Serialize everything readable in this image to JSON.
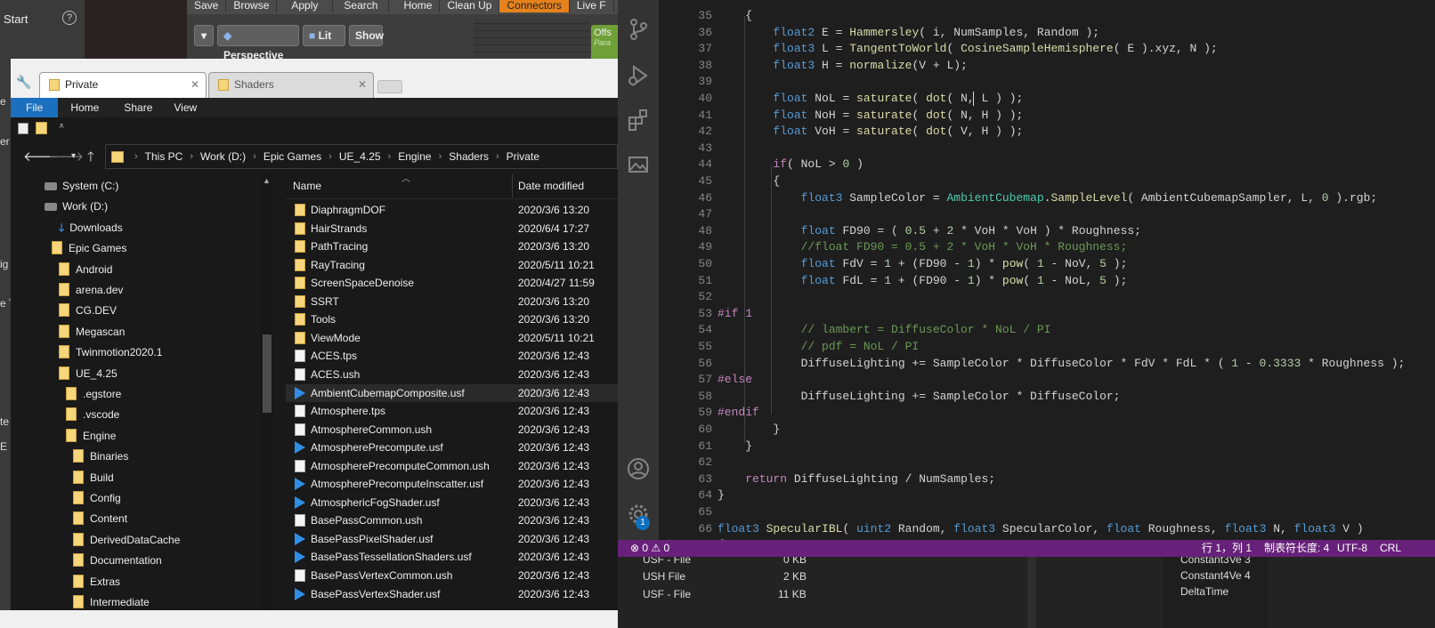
{
  "background": {
    "start_label": "Start",
    "help_icon": "?",
    "toolbar": [
      "Save",
      "Browse",
      "Apply",
      "Search",
      "Home",
      "Clean Up",
      "Connectors",
      "Live F"
    ],
    "viewport_buttons": [
      "Perspective",
      "Lit",
      "Show"
    ],
    "green_panel": [
      "Offs",
      "Para"
    ],
    "left_edge_letters": [
      "e",
      "er",
      "ig",
      "e T",
      "te",
      "E"
    ],
    "behind_list": [
      "USF - File",
      "0 KB",
      "USH File",
      "2 KB",
      "USF - File",
      "11 KB"
    ],
    "ue_params": [
      "Constant3Ve 3",
      "Constant4Ve 4",
      "DeltaTime"
    ]
  },
  "explorer": {
    "tabs": [
      {
        "label": "Private",
        "active": true
      },
      {
        "label": "Shaders",
        "active": false
      }
    ],
    "ribbon": [
      "File",
      "Home",
      "Share",
      "View"
    ],
    "address_crumbs": [
      "This PC",
      "Work (D:)",
      "Epic Games",
      "UE_4.25",
      "Engine",
      "Shaders",
      "Private"
    ],
    "nav_items": [
      {
        "label": "System (C:)",
        "kind": "drive"
      },
      {
        "label": "Work (D:)",
        "kind": "drive"
      },
      {
        "label": "Downloads",
        "kind": "download"
      },
      {
        "label": "Epic Games",
        "kind": "folder"
      },
      {
        "label": "Android",
        "kind": "folder"
      },
      {
        "label": "arena.dev",
        "kind": "folder"
      },
      {
        "label": "CG.DEV",
        "kind": "folder"
      },
      {
        "label": "Megascan",
        "kind": "folder"
      },
      {
        "label": "Twinmotion2020.1",
        "kind": "folder"
      },
      {
        "label": "UE_4.25",
        "kind": "folder"
      },
      {
        "label": ".egstore",
        "kind": "folder"
      },
      {
        "label": ".vscode",
        "kind": "folder"
      },
      {
        "label": "Engine",
        "kind": "folder"
      },
      {
        "label": "Binaries",
        "kind": "folder"
      },
      {
        "label": "Build",
        "kind": "folder"
      },
      {
        "label": "Config",
        "kind": "folder"
      },
      {
        "label": "Content",
        "kind": "folder"
      },
      {
        "label": "DerivedDataCache",
        "kind": "folder"
      },
      {
        "label": "Documentation",
        "kind": "folder"
      },
      {
        "label": "Extras",
        "kind": "folder"
      },
      {
        "label": "Intermediate",
        "kind": "folder"
      }
    ],
    "columns": {
      "name": "Name",
      "date": "Date modified"
    },
    "files": [
      {
        "name": "DiaphragmDOF",
        "date": "2020/3/6 13:20",
        "kind": "folder"
      },
      {
        "name": "HairStrands",
        "date": "2020/6/4 17:27",
        "kind": "folder"
      },
      {
        "name": "PathTracing",
        "date": "2020/3/6 13:20",
        "kind": "folder"
      },
      {
        "name": "RayTracing",
        "date": "2020/5/11 10:21",
        "kind": "folder"
      },
      {
        "name": "ScreenSpaceDenoise",
        "date": "2020/4/27 11:59",
        "kind": "folder"
      },
      {
        "name": "SSRT",
        "date": "2020/3/6 13:20",
        "kind": "folder"
      },
      {
        "name": "Tools",
        "date": "2020/3/6 13:20",
        "kind": "folder"
      },
      {
        "name": "ViewMode",
        "date": "2020/5/11 10:21",
        "kind": "folder"
      },
      {
        "name": "ACES.tps",
        "date": "2020/3/6 12:43",
        "kind": "doc"
      },
      {
        "name": "ACES.ush",
        "date": "2020/3/6 12:43",
        "kind": "doc"
      },
      {
        "name": "AmbientCubemapComposite.usf",
        "date": "2020/3/6 12:43",
        "kind": "usf"
      },
      {
        "name": "Atmosphere.tps",
        "date": "2020/3/6 12:43",
        "kind": "doc"
      },
      {
        "name": "AtmosphereCommon.ush",
        "date": "2020/3/6 12:43",
        "kind": "doc"
      },
      {
        "name": "AtmospherePrecompute.usf",
        "date": "2020/3/6 12:43",
        "kind": "usf"
      },
      {
        "name": "AtmospherePrecomputeCommon.ush",
        "date": "2020/3/6 12:43",
        "kind": "doc"
      },
      {
        "name": "AtmospherePrecomputeInscatter.usf",
        "date": "2020/3/6 12:43",
        "kind": "usf"
      },
      {
        "name": "AtmosphericFogShader.usf",
        "date": "2020/3/6 12:43",
        "kind": "usf"
      },
      {
        "name": "BasePassCommon.ush",
        "date": "2020/3/6 12:43",
        "kind": "doc"
      },
      {
        "name": "BasePassPixelShader.usf",
        "date": "2020/3/6 12:43",
        "kind": "usf"
      },
      {
        "name": "BasePassTessellationShaders.usf",
        "date": "2020/3/6 12:43",
        "kind": "usf"
      },
      {
        "name": "BasePassVertexCommon.ush",
        "date": "2020/3/6 12:43",
        "kind": "doc"
      },
      {
        "name": "BasePassVertexShader.usf",
        "date": "2020/3/6 12:43",
        "kind": "usf"
      }
    ]
  },
  "vscode": {
    "line_start": 35,
    "lines": [
      "    {",
      "        float2 E = Hammersley( i, NumSamples, Random );",
      "        float3 L = TangentToWorld( CosineSampleHemisphere( E ).xyz, N );",
      "        float3 H = normalize(V + L);",
      "",
      "        float NoL = saturate( dot( N, L ) );",
      "        float NoH = saturate( dot( N, H ) );",
      "        float VoH = saturate( dot( V, H ) );",
      "",
      "        if( NoL > 0 )",
      "        {",
      "            float3 SampleColor = AmbientCubemap.SampleLevel( AmbientCubemapSampler, L, 0 ).rgb;",
      "",
      "            float FD90 = ( 0.5 + 2 * VoH * VoH ) * Roughness;",
      "            //float FD90 = 0.5 + 2 * VoH * VoH * Roughness;",
      "            float FdV = 1 + (FD90 - 1) * pow( 1 - NoV, 5 );",
      "            float FdL = 1 + (FD90 - 1) * pow( 1 - NoL, 5 );",
      "",
      "#if 1",
      "            // lambert = DiffuseColor * NoL / PI",
      "            // pdf = NoL / PI",
      "            DiffuseLighting += SampleColor * DiffuseColor * FdV * FdL * ( 1 - 0.3333 * Roughness );",
      "#else",
      "            DiffuseLighting += SampleColor * DiffuseColor;",
      "#endif",
      "        }",
      "    }",
      "",
      "    return DiffuseLighting / NumSamples;",
      "}",
      "",
      "float3 SpecularIBL( uint2 Random, float3 SpecularColor, float Roughness, float3 N, float3 V )",
      "{"
    ],
    "status": {
      "errors": "0",
      "warnings": "0",
      "position": "行 1，列 1",
      "tab_size": "制表符长度: 4",
      "encoding": "UTF-8",
      "eol": "CRL"
    },
    "settings_badge": "1",
    "colors": {
      "statusbar": "#68217a",
      "keyword": "#569cd6",
      "function": "#dcdcaa",
      "type": "#4ec9b0",
      "number": "#b5cea8",
      "comment": "#6a9955",
      "preproc": "#c586c0"
    }
  }
}
